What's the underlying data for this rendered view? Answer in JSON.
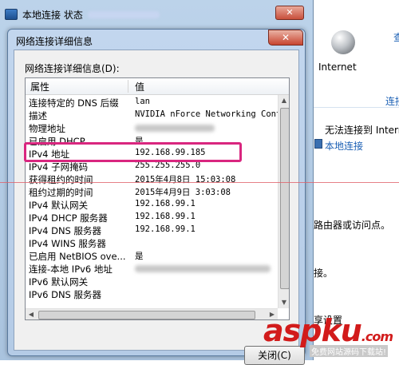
{
  "background_window": {
    "title": "本地连接 状态"
  },
  "right_panel": {
    "top_link": "查",
    "internet_label": "Internet",
    "link_text": "连接",
    "cannot_connect": "无法连接到 Interne",
    "local_connection": "本地连接",
    "router_text": "路由器或访问点。",
    "connect_text": "接。",
    "settings_text": "享设置"
  },
  "dialog": {
    "title": "网络连接详细信息",
    "close_glyph": "✕",
    "details_label": "网络连接详细信息(D):",
    "columns": {
      "property": "属性",
      "value": "值"
    },
    "rows": [
      {
        "property": "连接特定的 DNS 后缀",
        "value": "lan"
      },
      {
        "property": "描述",
        "value": "NVIDIA nForce Networking Contr"
      },
      {
        "property": "物理地址",
        "value": ""
      },
      {
        "property": "已启用 DHCP",
        "value": "是"
      },
      {
        "property": "IPv4 地址",
        "value": "192.168.99.185"
      },
      {
        "property": "IPv4 子网掩码",
        "value": "255.255.255.0"
      },
      {
        "property": "获得租约的时间",
        "value": "2015年4月8日 15:03:08"
      },
      {
        "property": "租约过期的时间",
        "value": "2015年4月9日 3:03:08"
      },
      {
        "property": "IPv4 默认网关",
        "value": "192.168.99.1"
      },
      {
        "property": "IPv4 DHCP 服务器",
        "value": "192.168.99.1"
      },
      {
        "property": "IPv4 DNS 服务器",
        "value": "192.168.99.1"
      },
      {
        "property": "IPv4 WINS 服务器",
        "value": ""
      },
      {
        "property": "已启用 NetBIOS ove...",
        "value": "是"
      },
      {
        "property": "连接-本地 IPv6 地址",
        "value": ""
      },
      {
        "property": "IPv6 默认网关",
        "value": ""
      },
      {
        "property": "IPv6 DNS 服务器",
        "value": ""
      }
    ],
    "close_button": "关闭(C)"
  },
  "watermark": {
    "logo": "aspku",
    "suffix": ".com",
    "sub": "免费网站源码下载站!"
  },
  "colors": {
    "highlight": "#d9267f",
    "watermark_red": "#d21b1b",
    "link_blue": "#1a5fb4"
  }
}
